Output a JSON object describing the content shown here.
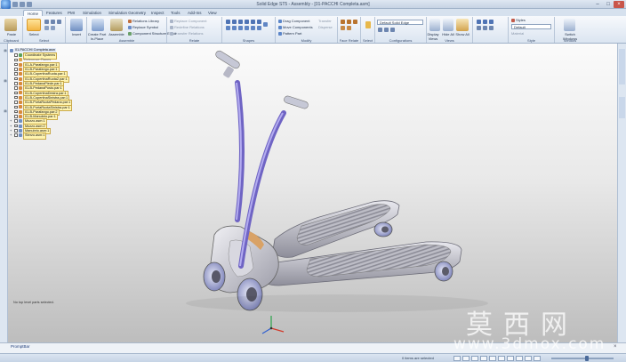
{
  "window": {
    "title": "Solid Edge ST5 - Assembly - [01-PACCHI Completa.asm]",
    "controls": [
      "minimize",
      "maximize",
      "close"
    ]
  },
  "ribbon": {
    "tabs": [
      "Home",
      "Features",
      "PMI",
      "Simulation",
      "Simulation Geometry",
      "Inspect",
      "Tools",
      "Add-Ins",
      "View"
    ],
    "active_tab": "Home",
    "groups": {
      "clipboard": {
        "label": "Clipboard",
        "paste": "Paste"
      },
      "select": {
        "label": "Select",
        "select_tool": "Select"
      },
      "assemble": {
        "label": "Assemble",
        "insert": "Insert",
        "assemble_btn": "Assemble",
        "create_part": "Create Part In-Place",
        "small": [
          "Relations Library",
          "Replace Symbol",
          "Component Structure Editor"
        ]
      },
      "relate": {
        "label": "Relate",
        "items": [
          "Replace Component",
          "Redefine Relations",
          "Transfer Relations"
        ]
      },
      "shapes": {
        "label": "Shapes"
      },
      "modify": {
        "label": "Modify",
        "items": [
          "Drag Component",
          "Move Components",
          "Pattern Part"
        ],
        "small": [
          "Transfer",
          "Disperse"
        ]
      },
      "face_relate": {
        "label": "Face Relate"
      },
      "select_tools": {
        "label": "Select"
      },
      "configurations": {
        "label": "Configurations",
        "value": "Default Solid Edge"
      },
      "views": {
        "label": "Views",
        "items": [
          "Display Views",
          "Hide All",
          "Show All"
        ]
      },
      "style": {
        "label": "Style",
        "items": [
          "Styles",
          "Default",
          "Material"
        ]
      },
      "window_group": {
        "label": "Window",
        "switch": "Switch Windows"
      }
    }
  },
  "tree": {
    "rows": [
      {
        "label": "01-PACCHI Completa.asm",
        "depth": 0,
        "highlight": "top"
      },
      {
        "label": "Coordinate Systems",
        "depth": 1
      },
      {
        "label": "Reference Planes",
        "depth": 1
      },
      {
        "label": "01-A-Parafango.par:1",
        "depth": 1
      },
      {
        "label": "01-B-Parafango.par:1",
        "depth": 1
      },
      {
        "label": "01-B-CopertinaRuota.par:1",
        "depth": 1
      },
      {
        "label": "01-B-CopertinaRuota2.par:1",
        "depth": 1
      },
      {
        "label": "01-B-PedanaPiede.par:1",
        "depth": 1
      },
      {
        "label": "01-B-PedanaPosto.par:1",
        "depth": 1
      },
      {
        "label": "01-B-CopertinaDestra.par:1",
        "depth": 1
      },
      {
        "label": "01-B-CopertinaSinistra.par:1",
        "depth": 1
      },
      {
        "label": "01-B-PortaRuotaPedana.par:1",
        "depth": 1
      },
      {
        "label": "01-B-PortaRuotaSinistra.par:1",
        "depth": 1
      },
      {
        "label": "01-B-Parafango.par:2",
        "depth": 1
      },
      {
        "label": "01-B-Manubrio.par:1",
        "depth": 1
      },
      {
        "label": "Mozzo.asm:1",
        "depth": 1
      },
      {
        "label": "Mozzo.asm:2",
        "depth": 1
      },
      {
        "label": "Manubrio.asm:1",
        "depth": 1
      },
      {
        "label": "Sterzo.asm:1",
        "depth": 1
      }
    ],
    "status_message": "No top level parts selected."
  },
  "prompt": {
    "label": "PromptBar"
  },
  "statusbar": {
    "selection": "0 items are selected"
  },
  "watermark": {
    "cn": "莫西网",
    "url": "www.3dmox.com"
  },
  "colors": {
    "accent": "#2b5ca8",
    "handlebar": "#8f86d8",
    "deck": "#c8c8d4",
    "wheel": "#bfc4e6"
  }
}
